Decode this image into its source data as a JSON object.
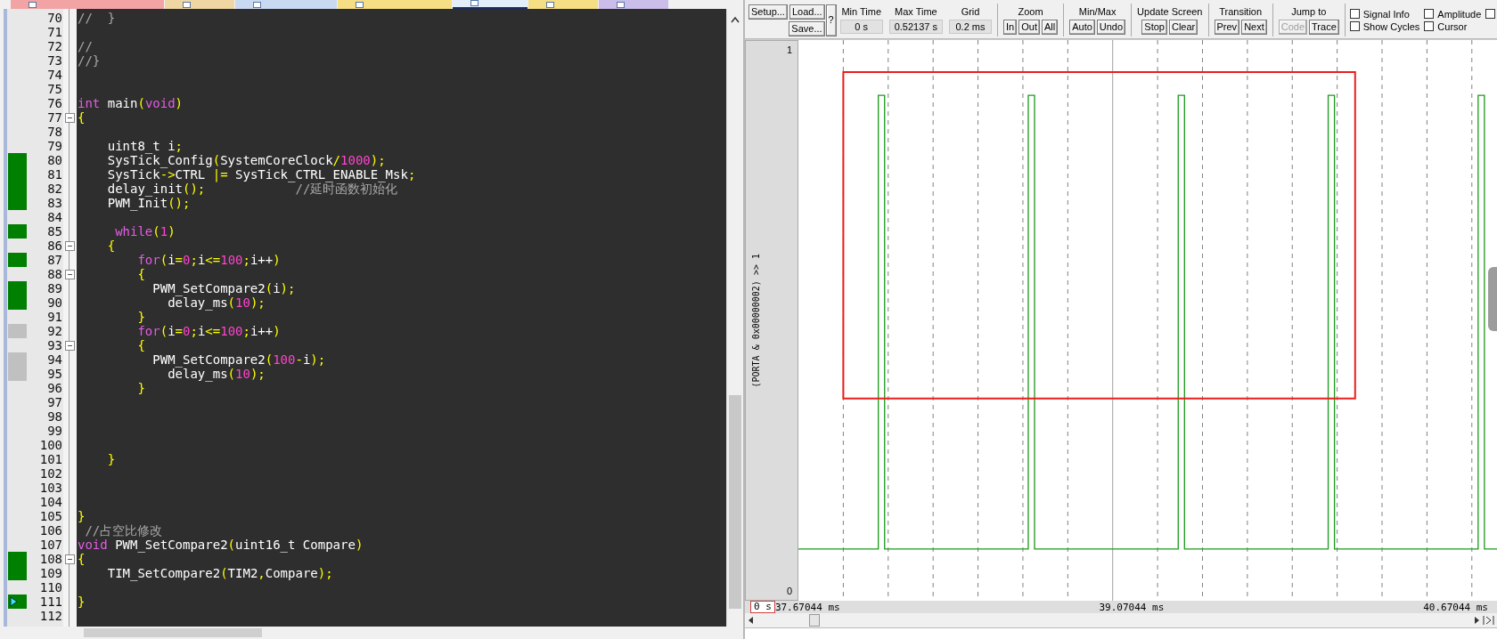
{
  "file_tabs": [
    {
      "color": "#f2a4a4",
      "selected": false
    },
    {
      "color": "#efd6a2",
      "selected": false
    },
    {
      "color": "#c9d9f1",
      "selected": false
    },
    {
      "color": "#f6de84",
      "selected": false
    },
    {
      "color": "#e4eefb",
      "selected": true
    },
    {
      "color": "#f6de84",
      "selected": false
    },
    {
      "color": "#cbbde9",
      "selected": false
    }
  ],
  "code": {
    "lines": [
      {
        "number": "70",
        "tokens": [
          {
            "kind": "comment",
            "text": "//  }"
          }
        ]
      },
      {
        "number": "71"
      },
      {
        "number": "72",
        "tokens": [
          {
            "kind": "comment",
            "text": "//"
          }
        ]
      },
      {
        "number": "73",
        "tokens": [
          {
            "kind": "comment",
            "text": "//}"
          }
        ]
      },
      {
        "number": "74"
      },
      {
        "number": "75"
      },
      {
        "number": "76",
        "tokens": [
          {
            "kind": "keyword",
            "text": "int"
          },
          {
            "kind": "plain",
            "text": " main"
          },
          {
            "kind": "punct",
            "text": "("
          },
          {
            "kind": "keyword",
            "text": "void"
          },
          {
            "kind": "punct",
            "text": ")"
          }
        ]
      },
      {
        "number": "77",
        "fold": true,
        "tokens": [
          {
            "kind": "punct",
            "text": "{"
          }
        ]
      },
      {
        "number": "78"
      },
      {
        "number": "79",
        "tokens": [
          {
            "kind": "plain",
            "text": "    uint8_t i"
          },
          {
            "kind": "punct",
            "text": ";"
          }
        ]
      },
      {
        "number": "80",
        "color": "#008000",
        "tokens": [
          {
            "kind": "plain",
            "text": "    SysTick_Config"
          },
          {
            "kind": "punct",
            "text": "("
          },
          {
            "kind": "plain",
            "text": "SystemCoreClock"
          },
          {
            "kind": "punct",
            "text": "/"
          },
          {
            "kind": "number",
            "text": "1000"
          },
          {
            "kind": "punct",
            "text": ");"
          }
        ]
      },
      {
        "number": "81",
        "color": "#008000",
        "tokens": [
          {
            "kind": "plain",
            "text": "    SysTick"
          },
          {
            "kind": "punct",
            "text": "->"
          },
          {
            "kind": "plain",
            "text": "CTRL "
          },
          {
            "kind": "punct",
            "text": "|="
          },
          {
            "kind": "plain",
            "text": " SysTick_CTRL_ENABLE_Msk"
          },
          {
            "kind": "punct",
            "text": ";"
          }
        ]
      },
      {
        "number": "82",
        "color": "#008000",
        "tokens": [
          {
            "kind": "plain",
            "text": "    delay_init"
          },
          {
            "kind": "punct",
            "text": "();"
          },
          {
            "kind": "comment",
            "text": "            //延时函数初始化"
          }
        ]
      },
      {
        "number": "83",
        "color": "#008000",
        "tokens": [
          {
            "kind": "plain",
            "text": "    PWM_Init"
          },
          {
            "kind": "punct",
            "text": "();"
          }
        ]
      },
      {
        "number": "84"
      },
      {
        "number": "85",
        "color": "#008000",
        "tokens": [
          {
            "kind": "keyword",
            "text": "     while"
          },
          {
            "kind": "punct",
            "text": "("
          },
          {
            "kind": "number",
            "text": "1"
          },
          {
            "kind": "punct",
            "text": ")"
          }
        ]
      },
      {
        "number": "86",
        "fold": true,
        "tokens": [
          {
            "kind": "punct",
            "text": "    {"
          }
        ]
      },
      {
        "number": "87",
        "color": "#008000",
        "tokens": [
          {
            "kind": "keyword",
            "text": "        for"
          },
          {
            "kind": "punct",
            "text": "("
          },
          {
            "kind": "plain",
            "text": "i"
          },
          {
            "kind": "punct",
            "text": "="
          },
          {
            "kind": "number",
            "text": "0"
          },
          {
            "kind": "punct",
            "text": ";"
          },
          {
            "kind": "plain",
            "text": "i"
          },
          {
            "kind": "punct",
            "text": "<="
          },
          {
            "kind": "number",
            "text": "100"
          },
          {
            "kind": "punct",
            "text": ";"
          },
          {
            "kind": "plain",
            "text": "i++"
          },
          {
            "kind": "punct",
            "text": ")"
          }
        ]
      },
      {
        "number": "88",
        "fold": true,
        "tokens": [
          {
            "kind": "punct",
            "text": "        {"
          }
        ]
      },
      {
        "number": "89",
        "color": "#008000",
        "tokens": [
          {
            "kind": "plain",
            "text": "          PWM_SetCompare2"
          },
          {
            "kind": "punct",
            "text": "("
          },
          {
            "kind": "plain",
            "text": "i"
          },
          {
            "kind": "punct",
            "text": ");"
          }
        ]
      },
      {
        "number": "90",
        "color": "#008000",
        "tokens": [
          {
            "kind": "plain",
            "text": "            delay_ms"
          },
          {
            "kind": "punct",
            "text": "("
          },
          {
            "kind": "number",
            "text": "10"
          },
          {
            "kind": "punct",
            "text": ");"
          }
        ]
      },
      {
        "number": "91",
        "tokens": [
          {
            "kind": "punct",
            "text": "        }"
          }
        ]
      },
      {
        "number": "92",
        "color": "#c0c0c0",
        "tokens": [
          {
            "kind": "keyword",
            "text": "        for"
          },
          {
            "kind": "punct",
            "text": "("
          },
          {
            "kind": "plain",
            "text": "i"
          },
          {
            "kind": "punct",
            "text": "="
          },
          {
            "kind": "number",
            "text": "0"
          },
          {
            "kind": "punct",
            "text": ";"
          },
          {
            "kind": "plain",
            "text": "i"
          },
          {
            "kind": "punct",
            "text": "<="
          },
          {
            "kind": "number",
            "text": "100"
          },
          {
            "kind": "punct",
            "text": ";"
          },
          {
            "kind": "plain",
            "text": "i++"
          },
          {
            "kind": "punct",
            "text": ")"
          }
        ]
      },
      {
        "number": "93",
        "fold": true,
        "tokens": [
          {
            "kind": "punct",
            "text": "        {"
          }
        ]
      },
      {
        "number": "94",
        "color": "#c0c0c0",
        "tokens": [
          {
            "kind": "plain",
            "text": "          PWM_SetCompare2"
          },
          {
            "kind": "punct",
            "text": "("
          },
          {
            "kind": "number",
            "text": "100"
          },
          {
            "kind": "punct",
            "text": "-"
          },
          {
            "kind": "plain",
            "text": "i"
          },
          {
            "kind": "punct",
            "text": ");"
          }
        ]
      },
      {
        "number": "95",
        "color": "#c0c0c0",
        "tokens": [
          {
            "kind": "plain",
            "text": "            delay_ms"
          },
          {
            "kind": "punct",
            "text": "("
          },
          {
            "kind": "number",
            "text": "10"
          },
          {
            "kind": "punct",
            "text": ");"
          }
        ]
      },
      {
        "number": "96",
        "tokens": [
          {
            "kind": "punct",
            "text": "        }"
          }
        ]
      },
      {
        "number": "97"
      },
      {
        "number": "98"
      },
      {
        "number": "99"
      },
      {
        "number": "100"
      },
      {
        "number": "101",
        "tokens": [
          {
            "kind": "punct",
            "text": "    }"
          }
        ]
      },
      {
        "number": "102"
      },
      {
        "number": "103"
      },
      {
        "number": "104"
      },
      {
        "number": "105",
        "tokens": [
          {
            "kind": "punct",
            "text": "}"
          }
        ]
      },
      {
        "number": "106",
        "tokens": [
          {
            "kind": "comment",
            "text": " //占空比修改"
          }
        ]
      },
      {
        "number": "107",
        "tokens": [
          {
            "kind": "keyword",
            "text": "void"
          },
          {
            "kind": "plain",
            "text": " PWM_SetCompare2"
          },
          {
            "kind": "punct",
            "text": "("
          },
          {
            "kind": "plain",
            "text": "uint16_t Compare"
          },
          {
            "kind": "punct",
            "text": ")"
          }
        ]
      },
      {
        "number": "108",
        "fold": true,
        "color": "#008000",
        "tokens": [
          {
            "kind": "punct",
            "text": "{"
          }
        ]
      },
      {
        "number": "109",
        "color": "#008000",
        "tokens": [
          {
            "kind": "plain",
            "text": "    TIM_SetCompare2"
          },
          {
            "kind": "punct",
            "text": "("
          },
          {
            "kind": "plain",
            "text": "TIM2"
          },
          {
            "kind": "punct",
            "text": ","
          },
          {
            "kind": "plain",
            "text": "Compare"
          },
          {
            "kind": "punct",
            "text": ");"
          }
        ]
      },
      {
        "number": "110"
      },
      {
        "number": "111",
        "color": "#008000",
        "current": true,
        "tokens": [
          {
            "kind": "punct",
            "text": "}"
          }
        ]
      },
      {
        "number": "112"
      }
    ]
  },
  "analyzer": {
    "toolbar": {
      "file_buttons": [
        {
          "label": "Setup...",
          "disabled": false
        },
        {
          "label": "Load...",
          "disabled": false
        },
        {
          "label": "Save...",
          "disabled": false
        }
      ],
      "help_button": "?",
      "readouts": [
        {
          "title": "Min Time",
          "value": "0 s"
        },
        {
          "title": "Max Time",
          "value": "0.52137 s"
        },
        {
          "title": "Grid",
          "value": "0.2 ms"
        }
      ],
      "groups": [
        {
          "title": "Zoom",
          "buttons": [
            {
              "label": "In",
              "disabled": false
            },
            {
              "label": "Out",
              "disabled": false
            },
            {
              "label": "All",
              "disabled": false
            }
          ]
        },
        {
          "title": "Min/Max",
          "buttons": [
            {
              "label": "Auto",
              "disabled": false
            },
            {
              "label": "Undo",
              "disabled": false
            }
          ]
        },
        {
          "title": "Update Screen",
          "buttons": [
            {
              "label": "Stop",
              "disabled": false
            },
            {
              "label": "Clear",
              "disabled": false
            }
          ]
        },
        {
          "title": "Transition",
          "buttons": [
            {
              "label": "Prev",
              "disabled": false
            },
            {
              "label": "Next",
              "disabled": false
            }
          ]
        },
        {
          "title": "Jump to",
          "buttons": [
            {
              "label": "Code",
              "disabled": true
            },
            {
              "label": "Trace",
              "disabled": false
            }
          ]
        }
      ],
      "checkboxes": [
        {
          "label": "Signal Info",
          "checked": false
        },
        {
          "label": "Show Cycles",
          "checked": false
        },
        {
          "label": "Amplitude",
          "checked": false
        },
        {
          "label": "Cursor",
          "checked": false
        }
      ],
      "trailing_checkbox": {
        "checked": false
      }
    },
    "signal": {
      "name": "(PORTA & 0x00000002) >> 1",
      "max_label": "1",
      "min_label": "0"
    },
    "time_axis": {
      "position_field": "0 s",
      "start": "37.67044 ms",
      "middle": "39.07044 ms",
      "end": "40.67044 ms"
    }
  }
}
